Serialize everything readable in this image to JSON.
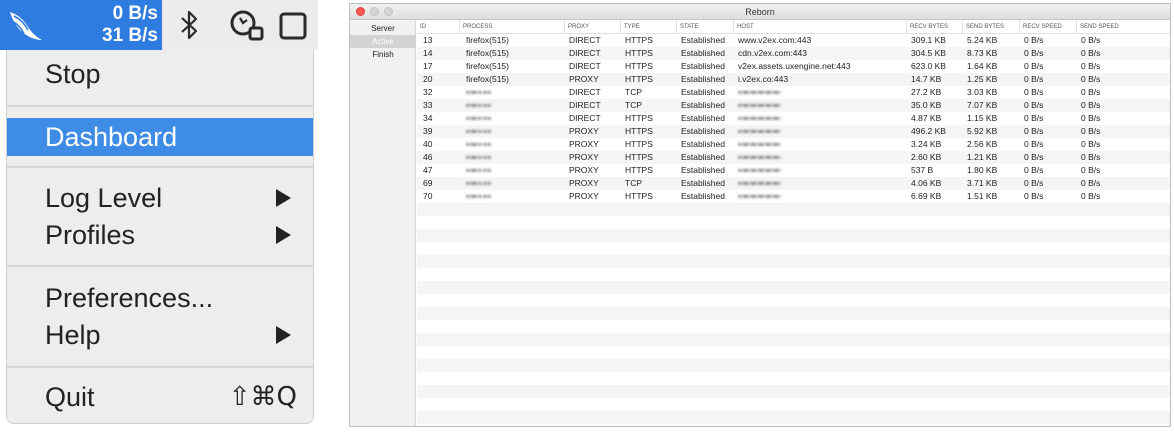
{
  "menubar": {
    "upload_speed": "0 B/s",
    "download_speed": "31 B/s",
    "icons": [
      "wing-icon",
      "bluetooth-icon",
      "search-icon",
      "window-square-icon"
    ],
    "accent_color": "#2f7ce0"
  },
  "menu": {
    "items": [
      {
        "label": "Stop"
      },
      {
        "label": "Dashboard",
        "highlighted": true
      },
      {
        "label": "Log Level",
        "submenu": true
      },
      {
        "label": "Profiles",
        "submenu": true
      },
      {
        "label": "Preferences..."
      },
      {
        "label": "Help",
        "submenu": true
      },
      {
        "label": "Quit",
        "shortcut": "⇧⌘Q"
      }
    ],
    "highlight_color": "#3e8ce6"
  },
  "window": {
    "title": "Reborn",
    "sidebar": [
      {
        "label": "Server"
      },
      {
        "label": "Active",
        "selected": true
      },
      {
        "label": "Finish"
      }
    ],
    "columns": [
      "ID",
      "PROCESS",
      "PROXY",
      "TYPE",
      "STATE",
      "HOST",
      "RECV BYTES",
      "SEND BYTES",
      "RECV SPEED",
      "SEND SPEED"
    ],
    "rows": [
      {
        "id": "13",
        "process": "firefox(515)",
        "proxy": "DIRECT",
        "type": "HTTPS",
        "state": "Established",
        "host": "www.v2ex.com:443",
        "recv_bytes": "309.1 KB",
        "send_bytes": "5.24 KB",
        "recv_speed": "0 B/s",
        "send_speed": "0 B/s"
      },
      {
        "id": "14",
        "process": "firefox(515)",
        "proxy": "DIRECT",
        "type": "HTTPS",
        "state": "Established",
        "host": "cdn.v2ex.com:443",
        "recv_bytes": "304.5 KB",
        "send_bytes": "8.73 KB",
        "recv_speed": "0 B/s",
        "send_speed": "0 B/s"
      },
      {
        "id": "17",
        "process": "firefox(515)",
        "proxy": "DIRECT",
        "type": "HTTPS",
        "state": "Established",
        "host": "v2ex.assets.uxengine.net:443",
        "recv_bytes": "623.0 KB",
        "send_bytes": "1.64 KB",
        "recv_speed": "0 B/s",
        "send_speed": "0 B/s"
      },
      {
        "id": "20",
        "process": "firefox(515)",
        "proxy": "PROXY",
        "type": "HTTPS",
        "state": "Established",
        "host": "i.v2ex.co:443",
        "recv_bytes": "14.7 KB",
        "send_bytes": "1.25 KB",
        "recv_speed": "0 B/s",
        "send_speed": "0 B/s"
      },
      {
        "id": "32",
        "process": "",
        "proxy": "DIRECT",
        "type": "TCP",
        "state": "Established",
        "host": "",
        "recv_bytes": "27.2 KB",
        "send_bytes": "3.03 KB",
        "recv_speed": "0 B/s",
        "send_speed": "0 B/s"
      },
      {
        "id": "33",
        "process": "",
        "proxy": "DIRECT",
        "type": "TCP",
        "state": "Established",
        "host": "",
        "recv_bytes": "35.0 KB",
        "send_bytes": "7.07 KB",
        "recv_speed": "0 B/s",
        "send_speed": "0 B/s"
      },
      {
        "id": "34",
        "process": "",
        "proxy": "DIRECT",
        "type": "HTTPS",
        "state": "Established",
        "host": "",
        "recv_bytes": "4.87 KB",
        "send_bytes": "1.15 KB",
        "recv_speed": "0 B/s",
        "send_speed": "0 B/s"
      },
      {
        "id": "39",
        "process": "",
        "proxy": "PROXY",
        "type": "HTTPS",
        "state": "Established",
        "host": "",
        "recv_bytes": "496.2 KB",
        "send_bytes": "5.92 KB",
        "recv_speed": "0 B/s",
        "send_speed": "0 B/s"
      },
      {
        "id": "40",
        "process": "",
        "proxy": "PROXY",
        "type": "HTTPS",
        "state": "Established",
        "host": "",
        "recv_bytes": "3.24 KB",
        "send_bytes": "2.56 KB",
        "recv_speed": "0 B/s",
        "send_speed": "0 B/s"
      },
      {
        "id": "46",
        "process": "",
        "proxy": "PROXY",
        "type": "HTTPS",
        "state": "Established",
        "host": "",
        "recv_bytes": "2.60 KB",
        "send_bytes": "1.21 KB",
        "recv_speed": "0 B/s",
        "send_speed": "0 B/s"
      },
      {
        "id": "47",
        "process": "",
        "proxy": "PROXY",
        "type": "HTTPS",
        "state": "Established",
        "host": "",
        "recv_bytes": "537 B",
        "send_bytes": "1.80 KB",
        "recv_speed": "0 B/s",
        "send_speed": "0 B/s"
      },
      {
        "id": "69",
        "process": "",
        "proxy": "PROXY",
        "type": "TCP",
        "state": "Established",
        "host": "",
        "recv_bytes": "4.06 KB",
        "send_bytes": "3.71 KB",
        "recv_speed": "0 B/s",
        "send_speed": "0 B/s"
      },
      {
        "id": "70",
        "process": "",
        "proxy": "PROXY",
        "type": "HTTPS",
        "state": "Established",
        "host": "",
        "recv_bytes": "6.69 KB",
        "send_bytes": "1.51 KB",
        "recv_speed": "0 B/s",
        "send_speed": "0 B/s"
      }
    ]
  }
}
